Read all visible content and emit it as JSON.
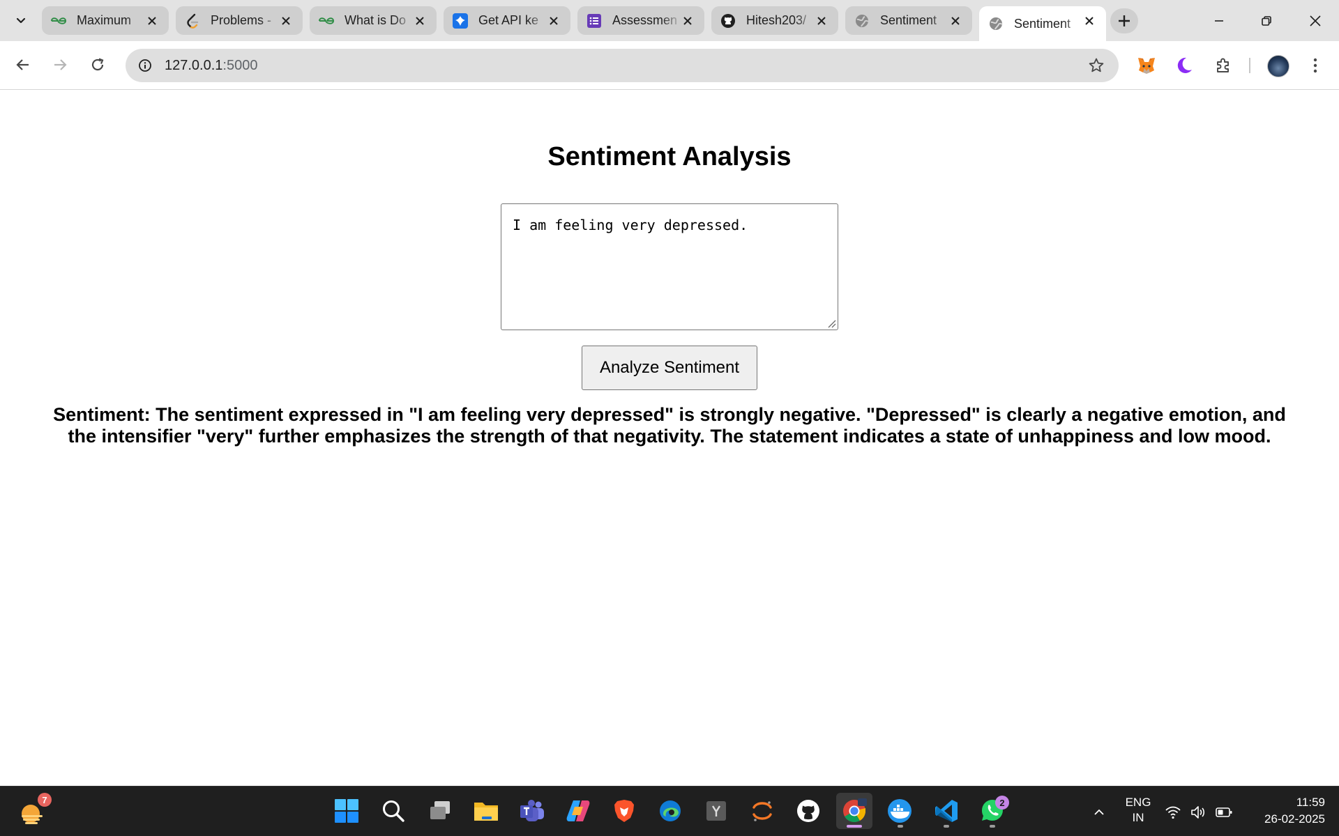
{
  "browser": {
    "tabs": [
      {
        "title": "Maximum",
        "favicon": "geeksforgeeks-icon",
        "active": false
      },
      {
        "title": "Problems -",
        "favicon": "leetcode-icon",
        "active": false
      },
      {
        "title": "What is Do",
        "favicon": "geeksforgeeks-icon",
        "active": false
      },
      {
        "title": "Get API ke",
        "favicon": "ai-studio-icon",
        "active": false
      },
      {
        "title": "Assessmen",
        "favicon": "forms-icon",
        "active": false
      },
      {
        "title": "Hitesh203/",
        "favicon": "github-icon",
        "active": false
      },
      {
        "title": "Sentiment",
        "favicon": "globe-icon",
        "active": false
      },
      {
        "title": "Sentiment",
        "favicon": "globe-icon",
        "active": true
      }
    ],
    "address": {
      "host": "127.0.0.1",
      "port": ":5000"
    },
    "extensions": [
      "metamask-icon",
      "dark-mode-moon-icon",
      "puzzle-extensions-icon"
    ]
  },
  "page": {
    "title": "Sentiment Analysis",
    "input_text": "I am feeling very depressed.",
    "button_label": "Analyze Sentiment",
    "result_text": "Sentiment: The sentiment expressed in \"I am feeling very depressed\" is strongly negative. \"Depressed\" is clearly a negative emotion, and the intensifier \"very\" further emphasizes the strength of that negativity. The statement indicates a state of unhappiness and low mood."
  },
  "taskbar": {
    "weather_badge": "7",
    "apps": [
      "windows-start-icon",
      "search-icon",
      "task-view-icon",
      "file-explorer-icon",
      "teams-icon",
      "copilot-icon",
      "brave-icon",
      "edge-icon",
      "yandex-icon",
      "jupyter-icon",
      "github-desktop-icon",
      "chrome-icon",
      "docker-icon",
      "vscode-icon",
      "whatsapp-icon"
    ],
    "whatsapp_badge": "2",
    "language": {
      "line1": "ENG",
      "line2": "IN"
    },
    "time": "11:59",
    "date": "26-02-2025"
  },
  "colors": {
    "page_bg": "#ffffff",
    "tabstrip_bg": "#e3e3e3",
    "taskbar_bg": "#1f1f1f",
    "accent": "#d59cf0"
  }
}
